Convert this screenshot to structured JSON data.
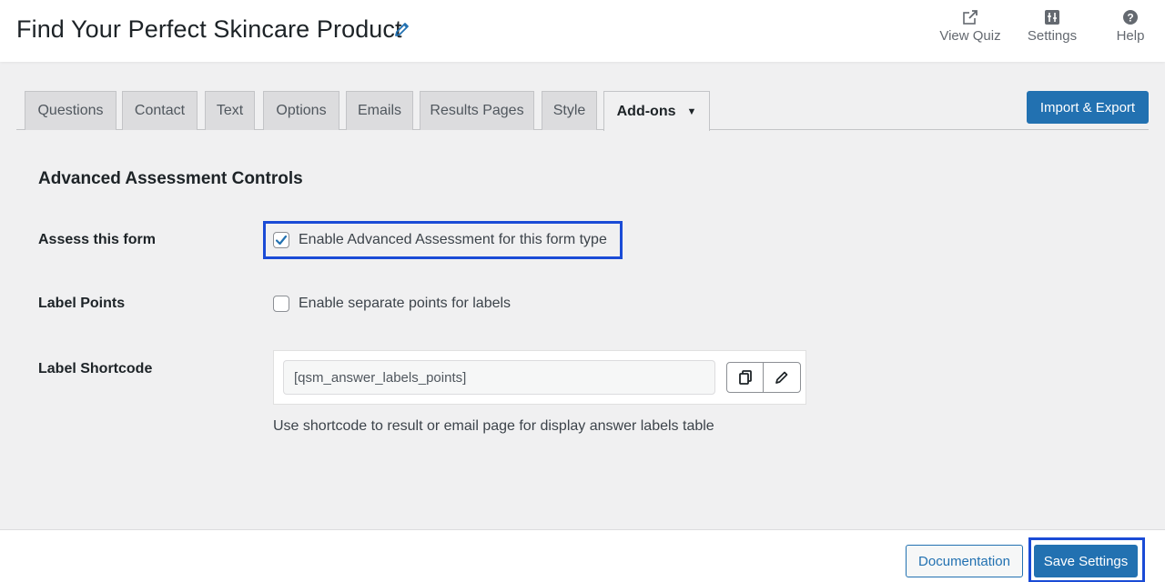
{
  "header": {
    "title": "Find Your Perfect Skincare Product",
    "actions": [
      {
        "label": "View Quiz",
        "icon": "external-link-icon"
      },
      {
        "label": "Settings",
        "icon": "settings-icon"
      },
      {
        "label": "Help",
        "icon": "help-icon"
      }
    ]
  },
  "tabs": [
    {
      "label": "Questions"
    },
    {
      "label": "Contact"
    },
    {
      "label": "Text"
    },
    {
      "label": "Options"
    },
    {
      "label": "Emails"
    },
    {
      "label": "Results Pages"
    },
    {
      "label": "Style"
    },
    {
      "label": "Add-ons",
      "active": true,
      "has_caret": true
    }
  ],
  "import_export_label": "Import & Export",
  "section": {
    "title": "Advanced Assessment Controls",
    "assess": {
      "label": "Assess this form",
      "checkbox_label": "Enable Advanced Assessment for this form type",
      "checked": true
    },
    "label_points": {
      "label": "Label Points",
      "checkbox_label": "Enable separate points for labels",
      "checked": false
    },
    "shortcode": {
      "label": "Label Shortcode",
      "value": "[qsm_answer_labels_points]",
      "help": "Use shortcode to result or email page for display answer labels table"
    }
  },
  "footer": {
    "documentation_label": "Documentation",
    "save_label": "Save Settings"
  },
  "colors": {
    "accent": "#2271b1",
    "highlight": "#1a4bd6",
    "background": "#f0f0f1"
  }
}
